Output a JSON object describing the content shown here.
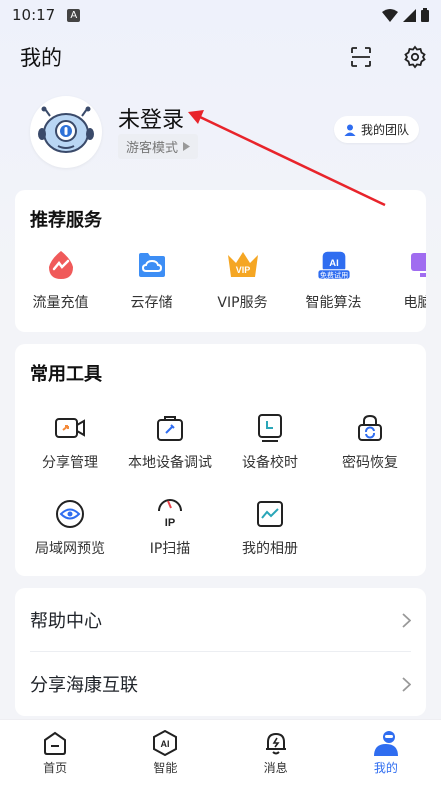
{
  "status_bar": {
    "time": "10:17",
    "notif_badge": "A"
  },
  "header": {
    "title": "我的",
    "scan_icon": "scan-icon",
    "settings_icon": "gear-icon"
  },
  "profile": {
    "username": "未登录",
    "mode": "游客模式",
    "team_button": "我的团队"
  },
  "recommended": {
    "title": "推荐服务",
    "items": [
      {
        "label": "流量充值",
        "icon": "data-topup-icon"
      },
      {
        "label": "云存储",
        "icon": "cloud-storage-icon"
      },
      {
        "label": "VIP服务",
        "icon": "vip-crown-icon"
      },
      {
        "label": "智能算法",
        "icon": "ai-algorithm-icon",
        "badge": "免费试用"
      },
      {
        "label": "电脑客",
        "icon": "pc-client-icon"
      }
    ]
  },
  "tools": {
    "title": "常用工具",
    "items": [
      {
        "label": "分享管理",
        "icon": "share-camera-icon"
      },
      {
        "label": "本地设备调试",
        "icon": "device-debug-icon"
      },
      {
        "label": "设备校时",
        "icon": "time-sync-icon"
      },
      {
        "label": "密码恢复",
        "icon": "password-recovery-icon"
      },
      {
        "label": "局域网预览",
        "icon": "lan-preview-icon"
      },
      {
        "label": "IP扫描",
        "icon": "ip-scan-icon"
      },
      {
        "label": "我的相册",
        "icon": "album-icon"
      }
    ]
  },
  "links": [
    {
      "label": "帮助中心"
    },
    {
      "label": "分享海康互联"
    }
  ],
  "bottom_nav": [
    {
      "label": "首页",
      "icon": "home-icon"
    },
    {
      "label": "智能",
      "icon": "ai-icon"
    },
    {
      "label": "消息",
      "icon": "bell-icon"
    },
    {
      "label": "我的",
      "icon": "user-icon",
      "active": true
    }
  ],
  "colors": {
    "accent": "#2f6df0",
    "annotation": "#e8242b"
  }
}
